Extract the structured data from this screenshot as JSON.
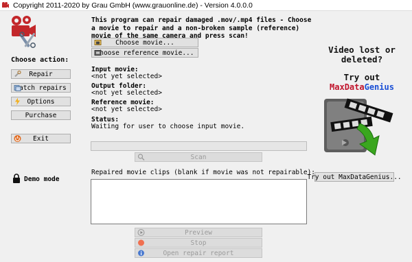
{
  "window": {
    "title": "Copyright 2011-2020 by Grau GmbH (www.grauonline.de) - Version 4.0.0.0"
  },
  "intro_text": "This program can repair damaged .mov/.mp4 files - Choose a movie to repair and a non-broken sample (reference) movie of the same camera and press scan!",
  "sidebar": {
    "heading": "Choose action:",
    "buttons": {
      "repair": "Repair",
      "batch": "Batch repairs",
      "options": "Options",
      "purchase": "Purchase",
      "exit": "Exit"
    },
    "demo_mode": "Demo mode"
  },
  "main": {
    "choose_movie": "Choose movie...",
    "choose_reference": "Choose reference movie...",
    "input_movie_label": "Input movie:",
    "input_movie_value": "<not yet selected>",
    "output_folder_label": "Output folder:",
    "output_folder_value": "<not yet selected>",
    "reference_movie_label": "Reference movie:",
    "reference_movie_value": "<not yet selected>",
    "status_label": "Status:",
    "status_value": "Waiting for user to choose input movie.",
    "scan": "Scan",
    "repaired_label": "Repaired movie clips (blank if movie was not repairable):",
    "preview": "Preview",
    "stop": "Stop",
    "open_report": "Open repair report"
  },
  "promo": {
    "line1": "Video lost or",
    "line2": "deleted?",
    "try_out": "Try out",
    "brand_a": "MaxData",
    "brand_b": "Genius",
    "button": "Try out MaxDataGenius..."
  },
  "colors": {
    "brand_red": "#c0122a",
    "brand_blue": "#1a4fd6",
    "arrow_green": "#3aa61e"
  }
}
